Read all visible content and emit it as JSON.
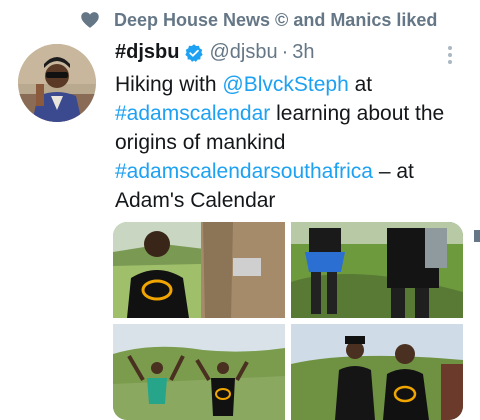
{
  "social_context": {
    "text": "Deep House News © and Manics liked"
  },
  "tweet": {
    "display_name": "#djsbu",
    "handle": "@djsbu",
    "separator": "·",
    "time": "3h",
    "text_parts": {
      "p1": "Hiking with ",
      "mention": "@BlvckSteph",
      "p2": " at ",
      "hashtag1": "#adamscalendar",
      "p3": " learning about the origins of mankind ",
      "hashtag2": "#adamscalendarsouthafrica",
      "p4": " – at Adam's Calendar"
    }
  },
  "icons": {
    "social": "heart-icon",
    "verified": "verified-badge-icon",
    "more": "more-vertical-icon"
  },
  "colors": {
    "link": "#1da1f2",
    "secondary_text": "#657786",
    "verified": "#1da1f2"
  }
}
